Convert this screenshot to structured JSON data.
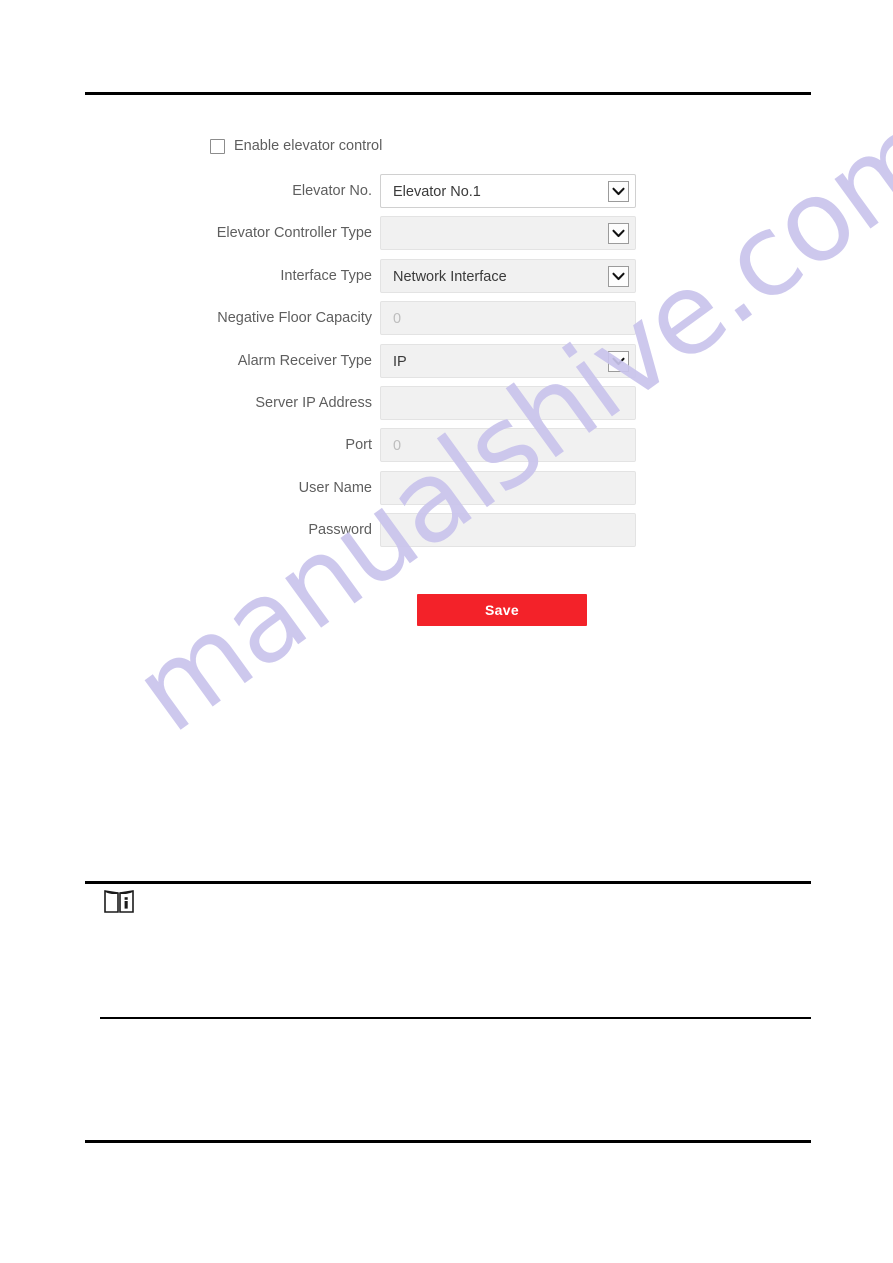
{
  "page": {
    "background": "#ffffff",
    "watermark": "manualshive.com",
    "watermark_color": "#c9c4ec"
  },
  "form": {
    "enable_checkbox": {
      "label": "Enable elevator control",
      "checked": false
    },
    "rows": [
      {
        "label": "Elevator No.",
        "type": "select",
        "value": "Elevator No.1",
        "placeholder": "",
        "enabled": true,
        "has_chevron": true
      },
      {
        "label": "Elevator Controller Type",
        "type": "select",
        "value": "",
        "placeholder": "",
        "enabled": false,
        "has_chevron": true
      },
      {
        "label": "Interface Type",
        "type": "select",
        "value": "Network Interface",
        "placeholder": "",
        "enabled": false,
        "has_chevron": true
      },
      {
        "label": "Negative Floor Capacity",
        "type": "text",
        "value": "",
        "placeholder": "0",
        "enabled": false,
        "has_chevron": false
      },
      {
        "label": "Alarm Receiver Type",
        "type": "select",
        "value": "IP",
        "placeholder": "",
        "enabled": false,
        "has_chevron": true
      },
      {
        "label": "Server IP Address",
        "type": "text",
        "value": "",
        "placeholder": "",
        "enabled": false,
        "has_chevron": false
      },
      {
        "label": "Port",
        "type": "text",
        "value": "",
        "placeholder": "0",
        "enabled": false,
        "has_chevron": false
      },
      {
        "label": "User Name",
        "type": "text",
        "value": "",
        "placeholder": "",
        "enabled": false,
        "has_chevron": false
      },
      {
        "label": "Password",
        "type": "password",
        "value": "",
        "placeholder": "",
        "enabled": false,
        "has_chevron": false
      }
    ],
    "save_label": "Save",
    "save_color": "#f32229"
  },
  "note": {
    "icon": "note-book-info-icon"
  }
}
